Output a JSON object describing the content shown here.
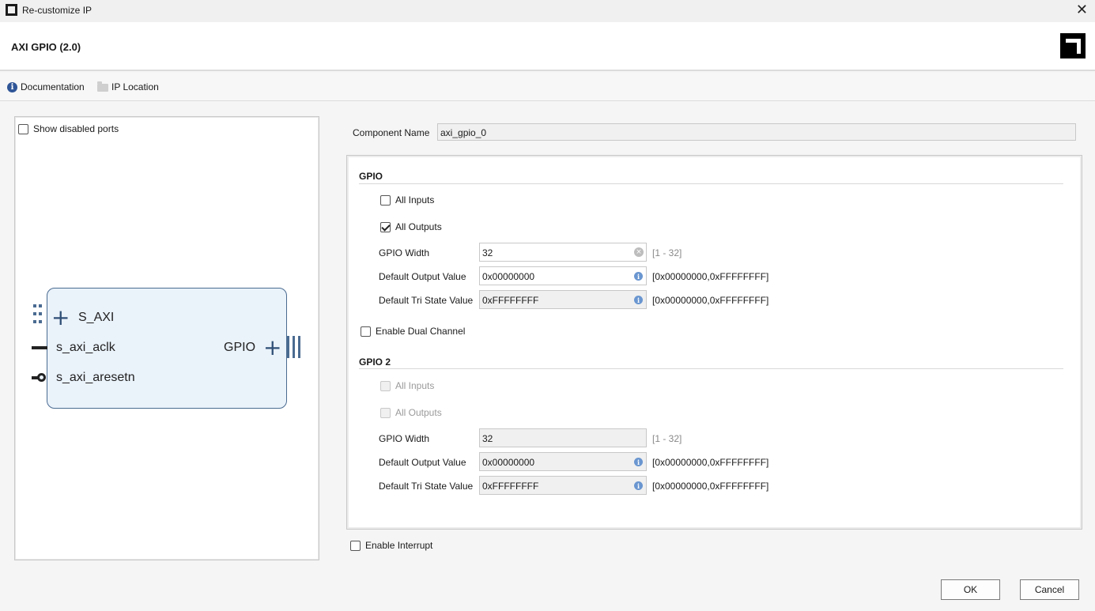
{
  "window": {
    "title": "Re-customize IP"
  },
  "header": {
    "ip_title": "AXI GPIO (2.0)"
  },
  "toolbar": {
    "documentation": "Documentation",
    "ip_location": "IP Location"
  },
  "symbol_panel": {
    "show_disabled_ports": "Show disabled ports",
    "show_disabled_checked": false,
    "ports": {
      "s_axi": "S_AXI",
      "s_axi_aclk": "s_axi_aclk",
      "s_axi_aresetn": "s_axi_aresetn",
      "gpio": "GPIO"
    }
  },
  "component": {
    "label": "Component Name",
    "value": "axi_gpio_0"
  },
  "gpio": {
    "title": "GPIO",
    "all_inputs": {
      "label": "All Inputs",
      "checked": false
    },
    "all_outputs": {
      "label": "All Outputs",
      "checked": true
    },
    "width": {
      "label": "GPIO Width",
      "value": "32",
      "range": "[1 - 32]"
    },
    "default_output": {
      "label": "Default Output Value",
      "value": "0x00000000",
      "range": "[0x00000000,0xFFFFFFFF]"
    },
    "default_tri": {
      "label": "Default Tri State Value",
      "value": "0xFFFFFFFF",
      "range": "[0x00000000,0xFFFFFFFF]"
    }
  },
  "dual_channel": {
    "label": "Enable Dual Channel",
    "checked": false
  },
  "gpio2": {
    "title": "GPIO 2",
    "all_inputs": {
      "label": "All Inputs",
      "checked": false
    },
    "all_outputs": {
      "label": "All Outputs",
      "checked": false
    },
    "width": {
      "label": "GPIO Width",
      "value": "32",
      "range": "[1 - 32]"
    },
    "default_output": {
      "label": "Default Output Value",
      "value": "0x00000000",
      "range": "[0x00000000,0xFFFFFFFF]"
    },
    "default_tri": {
      "label": "Default Tri State Value",
      "value": "0xFFFFFFFF",
      "range": "[0x00000000,0xFFFFFFFF]"
    }
  },
  "interrupt": {
    "label": "Enable Interrupt",
    "checked": false
  },
  "buttons": {
    "ok": "OK",
    "cancel": "Cancel"
  },
  "icons": {
    "close": "close-icon",
    "documentation": "info-icon",
    "ip_location": "folder-icon",
    "brand": "amd-logo"
  },
  "colors": {
    "block_fill": "#eaf2fa",
    "block_border": "#4a6b91",
    "info_blue": "#6a96d0"
  }
}
